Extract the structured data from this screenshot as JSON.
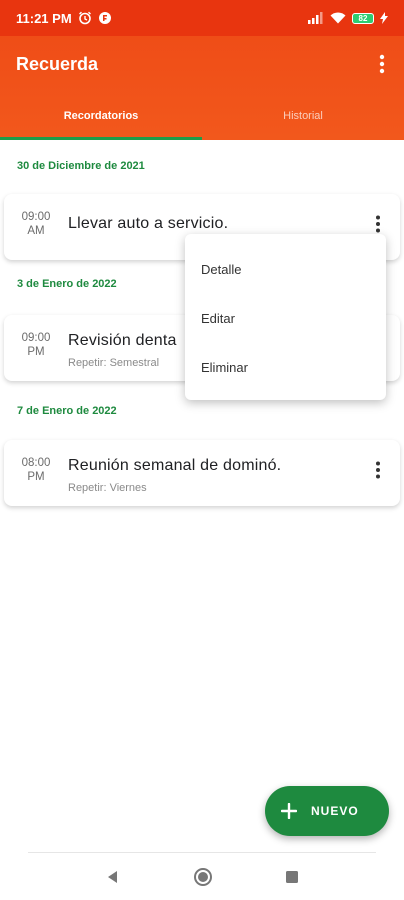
{
  "status_bar": {
    "time": "11:21 PM",
    "battery": "82"
  },
  "app": {
    "title": "Recuerda"
  },
  "tabs": [
    {
      "label": "Recordatorios",
      "active": true
    },
    {
      "label": "Historial",
      "active": false
    }
  ],
  "groups": [
    {
      "date": "30 de Diciembre de 2021",
      "reminders": [
        {
          "time": "09:00",
          "ampm": "AM",
          "title": "Llevar auto a servicio.",
          "repeat": ""
        }
      ]
    },
    {
      "date": "3 de Enero de 2022",
      "reminders": [
        {
          "time": "09:00",
          "ampm": "PM",
          "title": "Revisión denta",
          "repeat": "Repetir: Semestral"
        }
      ]
    },
    {
      "date": "7 de Enero de 2022",
      "reminders": [
        {
          "time": "08:00",
          "ampm": "PM",
          "title": "Reunión semanal de dominó.",
          "repeat": "Repetir: Viernes"
        }
      ]
    }
  ],
  "context_menu": {
    "items": [
      "Detalle",
      "Editar",
      "Eliminar"
    ]
  },
  "fab": {
    "label": "NUEVO"
  },
  "colors": {
    "primary": "#ef4d17",
    "accent": "#1e8a3f"
  }
}
